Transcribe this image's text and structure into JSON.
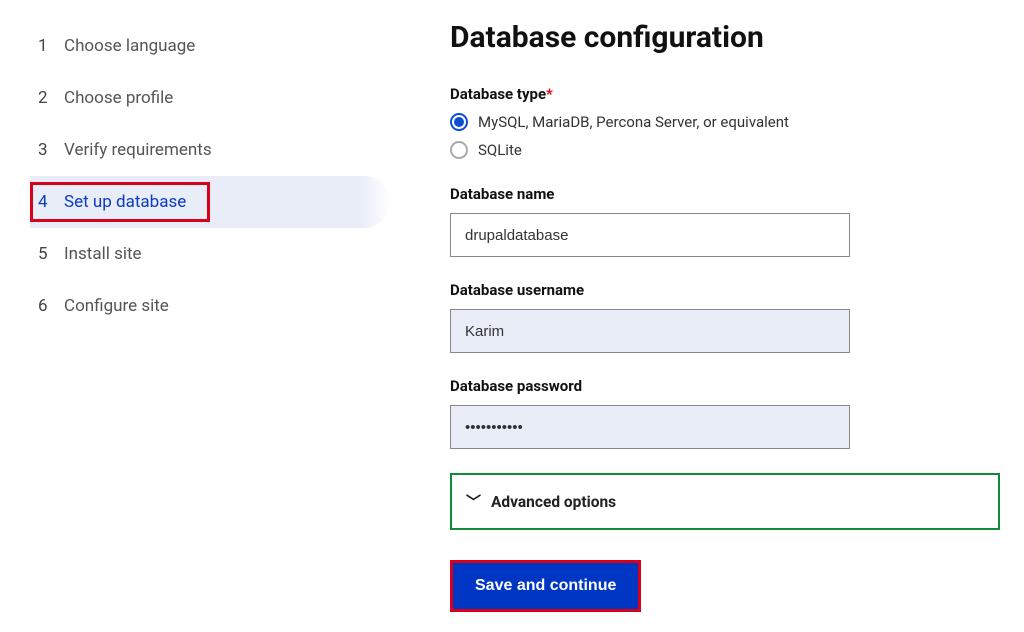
{
  "sidebar": {
    "steps": [
      {
        "num": "1",
        "label": "Choose language"
      },
      {
        "num": "2",
        "label": "Choose profile"
      },
      {
        "num": "3",
        "label": "Verify requirements"
      },
      {
        "num": "4",
        "label": "Set up database"
      },
      {
        "num": "5",
        "label": "Install site"
      },
      {
        "num": "6",
        "label": "Configure site"
      }
    ]
  },
  "main": {
    "heading": "Database configuration",
    "db_type_label": "Database type",
    "required_marker": "*",
    "db_type_options": {
      "mysql": "MySQL, MariaDB, Percona Server, or equivalent",
      "sqlite": "SQLite"
    },
    "db_name_label": "Database name",
    "db_name_value": "drupaldatabase",
    "db_user_label": "Database username",
    "db_user_value": "Karim",
    "db_pass_label": "Database password",
    "db_pass_value": "•••••••••••",
    "advanced_label": "Advanced options",
    "save_label": "Save and continue"
  }
}
